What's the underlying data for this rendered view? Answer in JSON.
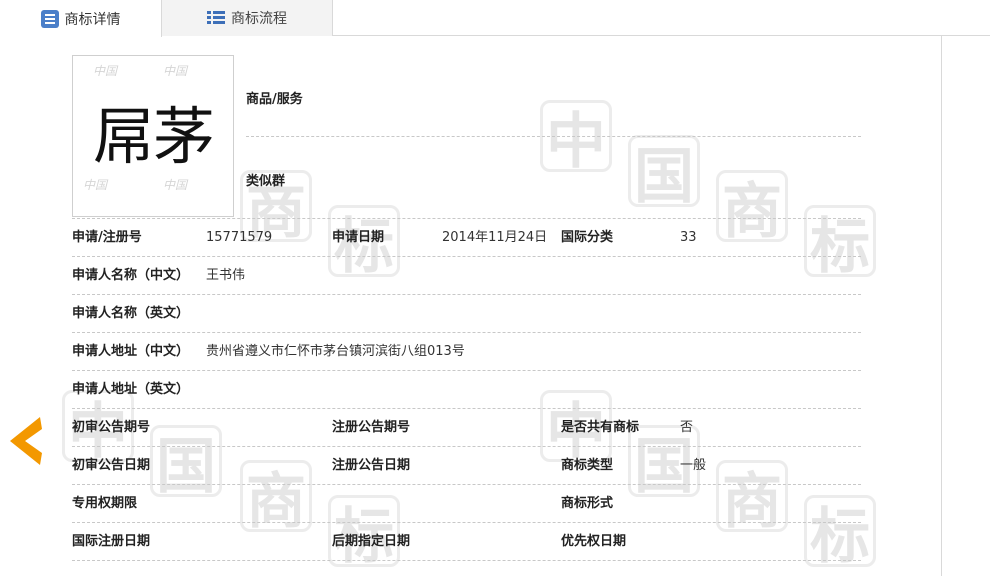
{
  "tabs": [
    {
      "label": "商标详情",
      "icon": "list-document-icon",
      "active": true
    },
    {
      "label": "商标流程",
      "icon": "list-icon",
      "active": false
    }
  ],
  "watermark": [
    "中",
    "国",
    "商",
    "标"
  ],
  "trademark_image": {
    "mark_text": "屌茅",
    "background_text": "中国"
  },
  "goods_label": "商品/服务",
  "similar_group_label": "类似群",
  "fields": {
    "reg_no_label": "申请/注册号",
    "reg_no": "15771579",
    "apply_date_label": "申请日期",
    "apply_date": "2014年11月24日",
    "intl_class_label": "国际分类",
    "intl_class": "33",
    "applicant_cn_label": "申请人名称（中文）",
    "applicant_cn": "王书伟",
    "applicant_en_label": "申请人名称（英文）",
    "applicant_en": "",
    "address_cn_label": "申请人地址（中文）",
    "address_cn": "贵州省遵义市仁怀市茅台镇河滨街八组013号",
    "address_en_label": "申请人地址（英文）",
    "address_en": "",
    "prelim_issue_label": "初审公告期号",
    "prelim_issue": "",
    "reg_issue_label": "注册公告期号",
    "reg_issue": "",
    "shared_label": "是否共有商标",
    "shared": "否",
    "prelim_date_label": "初审公告日期",
    "prelim_date": "",
    "reg_date_label": "注册公告日期",
    "reg_date": "",
    "tm_type_label": "商标类型",
    "tm_type": "一般",
    "exclusive_label": "专用权期限",
    "exclusive": "",
    "tm_form_label": "商标形式",
    "tm_form": "",
    "intl_reg_date_label": "国际注册日期",
    "intl_reg_date": "",
    "later_date_label": "后期指定日期",
    "later_date": "",
    "priority_date_label": "优先权日期",
    "priority_date": ""
  },
  "colors": {
    "accent": "#4b7fc9",
    "back_arrow": "#f39800"
  }
}
